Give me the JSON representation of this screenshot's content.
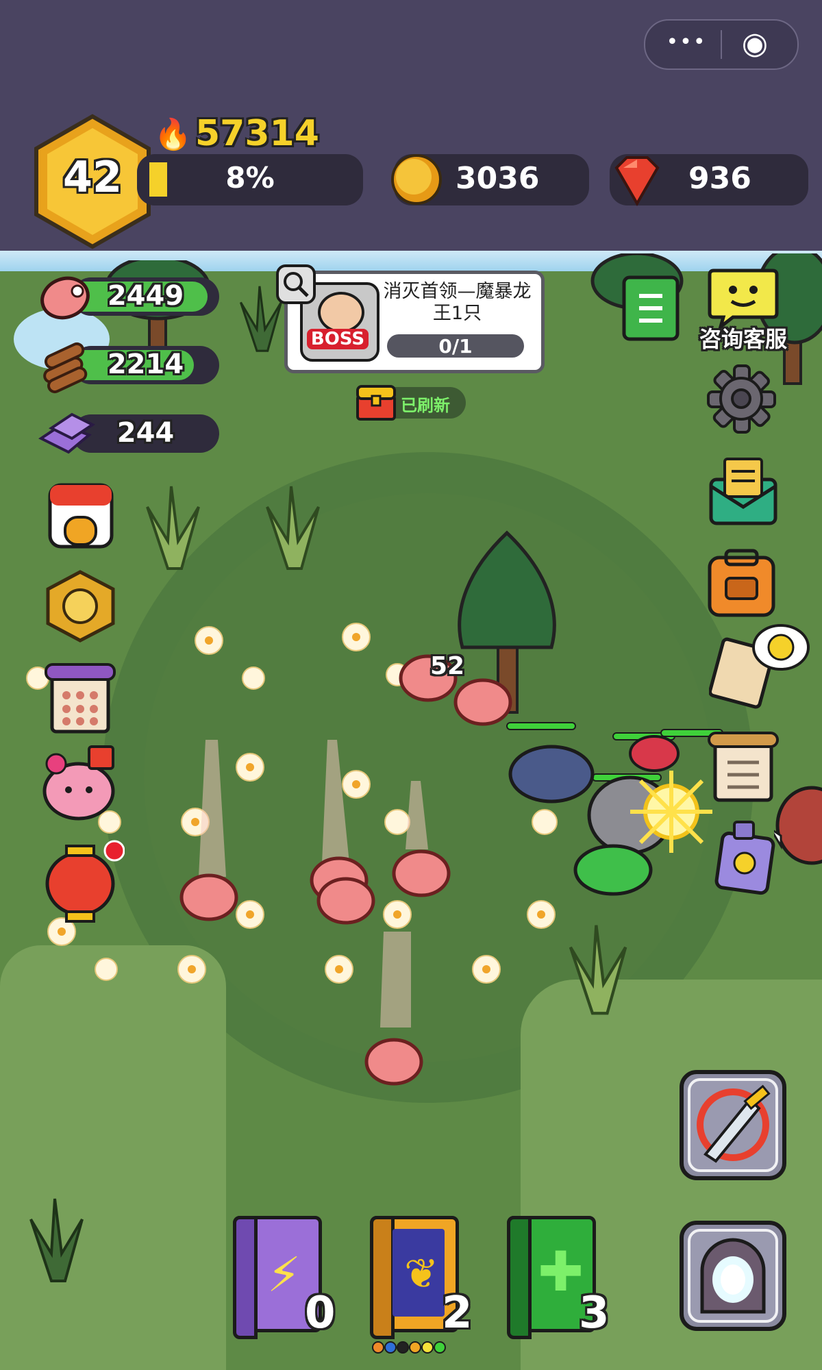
{
  "window_controls": {
    "more_icon": "•••",
    "target_icon": "◉"
  },
  "player": {
    "level": "42",
    "power": "57314",
    "exp_percent": "8%",
    "exp_fraction": 0.08
  },
  "currency": {
    "gold": "3036",
    "gems": "936"
  },
  "resources": [
    {
      "name": "meat",
      "value": "2449",
      "fill": 0.92
    },
    {
      "name": "wood",
      "value": "2214",
      "fill": 0.83
    },
    {
      "name": "crystal",
      "value": "244",
      "fill": 0.0
    }
  ],
  "quest": {
    "title": "消灭首领—魔暴龙王1只",
    "progress": "0/1",
    "boss_badge": "BOSS"
  },
  "chest": {
    "status": "已刷新"
  },
  "support": {
    "label": "咨询客服"
  },
  "scene": {
    "damage_number": "52"
  },
  "skill_books": [
    {
      "name": "lightning-book",
      "count": "0",
      "color": "#9b6fd8"
    },
    {
      "name": "wing-book",
      "count": "2",
      "color": "#f0a524"
    },
    {
      "name": "heal-book",
      "count": "3",
      "color": "#2fae3b"
    }
  ],
  "colors": {
    "accent_gold": "#f5c21b",
    "gem_red": "#e8402e",
    "hud_bg": "#4a4461"
  }
}
